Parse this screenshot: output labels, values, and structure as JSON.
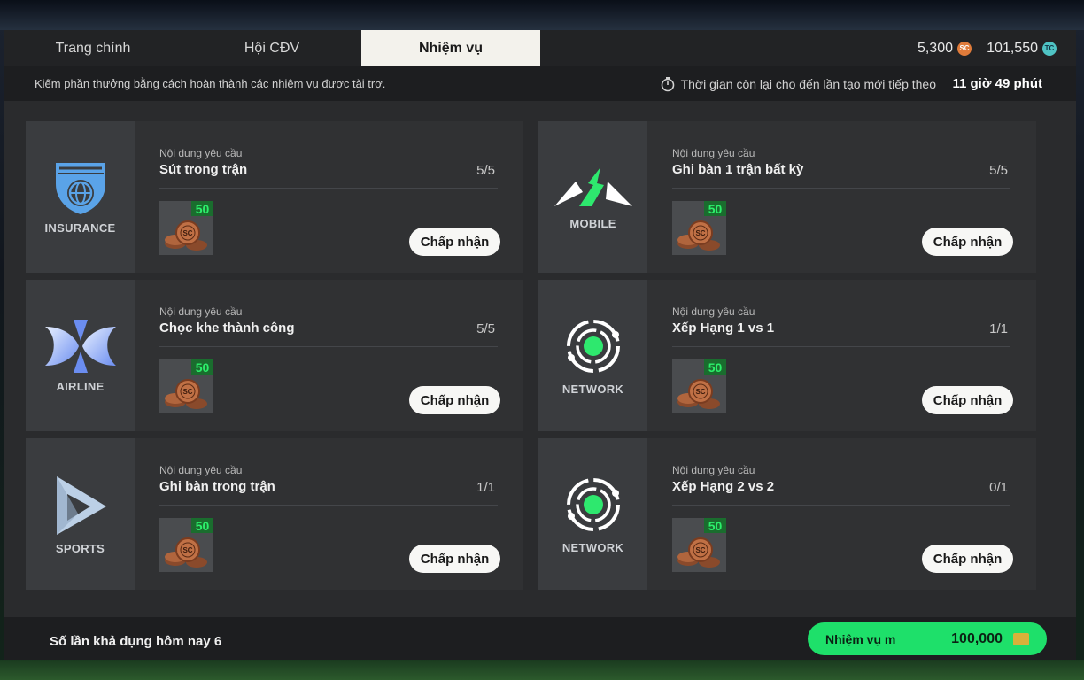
{
  "tabs": [
    {
      "label": "Trang chính"
    },
    {
      "label": "Hội CĐV"
    },
    {
      "label": "Nhiệm vụ"
    }
  ],
  "currency": {
    "sc_amount": "5,300",
    "sc_icon": "SC",
    "tc_amount": "101,550",
    "tc_icon": "TC"
  },
  "info": {
    "description": "Kiếm phần thưởng bằng cách hoàn thành các nhiệm vụ được tài trợ.",
    "timer_label": "Thời gian còn lại cho đến lần tạo mới tiếp theo",
    "timer_value": "11 giờ 49 phút"
  },
  "missions": [
    {
      "sponsor": "INSURANCE",
      "label": "Nội dung yêu cầu",
      "requirement": "Sút trong trận",
      "progress": "5/5",
      "reward": "50",
      "coin": "SC",
      "button": "Chấp nhận"
    },
    {
      "sponsor": "MOBILE",
      "label": "Nội dung yêu cầu",
      "requirement": "Ghi bàn 1 trận bất kỳ",
      "progress": "5/5",
      "reward": "50",
      "coin": "SC",
      "button": "Chấp nhận"
    },
    {
      "sponsor": "AIRLINE",
      "label": "Nội dung yêu cầu",
      "requirement": "Chọc khe thành công",
      "progress": "5/5",
      "reward": "50",
      "coin": "SC",
      "button": "Chấp nhận"
    },
    {
      "sponsor": "NETWORK",
      "label": "Nội dung yêu cầu",
      "requirement": "Xếp Hạng 1 vs 1",
      "progress": "1/1",
      "reward": "50",
      "coin": "SC",
      "button": "Chấp nhận"
    },
    {
      "sponsor": "SPORTS",
      "label": "Nội dung yêu cầu",
      "requirement": "Ghi bàn trong trận",
      "progress": "1/1",
      "reward": "50",
      "coin": "SC",
      "button": "Chấp nhận"
    },
    {
      "sponsor": "NETWORK",
      "label": "Nội dung yêu cầu",
      "requirement": "Xếp Hạng 2 vs 2",
      "progress": "0/1",
      "reward": "50",
      "coin": "SC",
      "button": "Chấp nhận"
    }
  ],
  "footer": {
    "uses_today": "Số lần khả dụng hôm nay 6",
    "mission_button_label": "Nhiệm vụ m",
    "mission_button_amount": "100,000"
  },
  "colors": {
    "accent_green": "#1ee06a",
    "reward_green": "#2cf06b"
  }
}
